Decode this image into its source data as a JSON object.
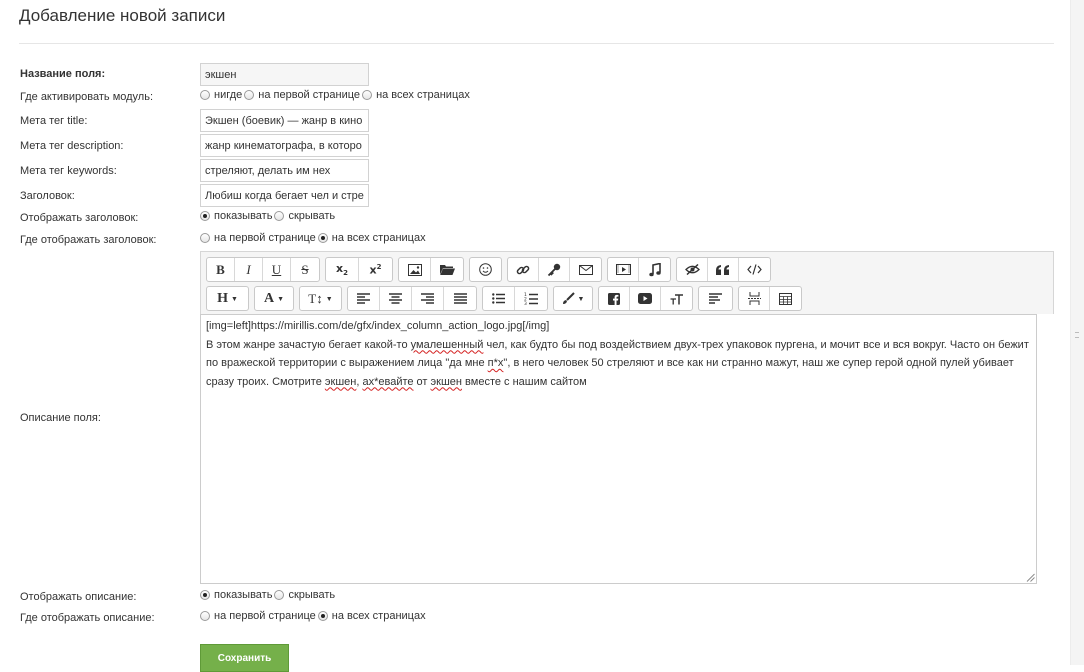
{
  "page": {
    "title": "Добавление новой записи"
  },
  "form": {
    "name": {
      "label": "Название поля:",
      "value": "экшен"
    },
    "activate": {
      "label": "Где активировать модуль:",
      "options": [
        "нигде",
        "на первой странице",
        "на всех страницах"
      ],
      "selected": -1
    },
    "meta_title": {
      "label": "Мета тег title:",
      "value": "Экшен (боевик) — жанр в кино"
    },
    "meta_description": {
      "label": "Мета тег description:",
      "value": "жанр кинематографа, в которо"
    },
    "meta_keywords": {
      "label": "Мета тег keywords:",
      "value": "стреляют, делать им нех"
    },
    "heading": {
      "label": "Заголовок:",
      "value": "Любиш когда бегает чел и стре"
    },
    "show_heading": {
      "label": "Отображать заголовок:",
      "options": [
        "показывать",
        "скрывать"
      ],
      "selected": 0
    },
    "heading_where": {
      "label": "Где отображать заголовок:",
      "options": [
        "на первой странице",
        "на всех страницах"
      ],
      "selected": 1
    },
    "description": {
      "label": "Описание поля:",
      "line1": "[img=left]https://mirillis.com/de/gfx/index_column_action_logo.jpg[/img]",
      "p_a": "В этом жанре зачастую бегает какой-то ",
      "p_w1": "умалешенный",
      "p_b": " чел, как будто бы под воздействием двух-трех упаковок пургена, и мочит все и вся вокруг. Часто он бежит по вражеской территории с выражением лица \"да мне ",
      "p_w2": "п*х",
      "p_c": "\", в него человек 50 стреляют и все как ни странно мажут, наш же супер герой одной пулей убивает сразу троих. Смотрите ",
      "p_w3": "экшен",
      "p_d": ", ",
      "p_w4": "ах*евайте",
      "p_e": " от ",
      "p_w5": "экшен",
      "p_f": " вместе с нашим сайтом"
    },
    "show_description": {
      "label": "Отображать описание:",
      "options": [
        "показывать",
        "скрывать"
      ],
      "selected": 0
    },
    "description_where": {
      "label": "Где отображать описание:",
      "options": [
        "на первой странице",
        "на всех страницах"
      ],
      "selected": 1
    },
    "save_label": "Сохранить"
  },
  "toolbar": {
    "bold": "B",
    "italic": "I",
    "underline": "U",
    "strike": "S",
    "heading": "H",
    "font_color": "A",
    "font_size": "T↕"
  },
  "colors": {
    "save": "#75b04a",
    "border": "#d2d2d2"
  },
  "icons": [
    "bold-icon",
    "italic-icon",
    "underline-icon",
    "strikethrough-icon",
    "subscript-icon",
    "superscript-icon",
    "image-icon",
    "folder-icon",
    "smiley-icon",
    "link-icon",
    "key-icon",
    "envelope-icon",
    "video-icon",
    "music-icon",
    "hidden-icon",
    "quote-icon",
    "code-icon",
    "heading-icon",
    "font-color-icon",
    "font-size-icon",
    "align-left-icon",
    "align-center-icon",
    "align-right-icon",
    "align-justify-icon",
    "bullet-list-icon",
    "numbered-list-icon",
    "brush-icon",
    "facebook-icon",
    "youtube-icon",
    "clear-format-icon",
    "paragraph-icon",
    "page-break-icon",
    "table-icon"
  ]
}
